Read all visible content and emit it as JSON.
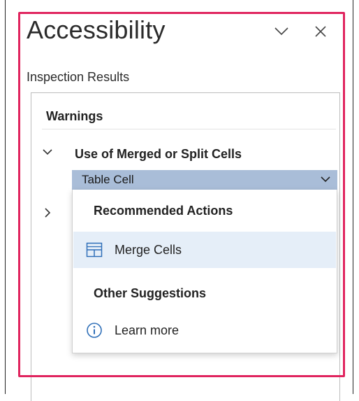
{
  "pane": {
    "title": "Accessibility",
    "section_label": "Inspection Results"
  },
  "results": {
    "warnings_heading": "Warnings",
    "issue": {
      "title": "Use of Merged or Split Cells",
      "expanded": true
    },
    "dropdown": {
      "selected": "Table Cell"
    }
  },
  "menu": {
    "recommended_heading": "Recommended Actions",
    "merge_label": "Merge Cells",
    "other_heading": "Other Suggestions",
    "learn_more_label": "Learn more"
  },
  "icons": {
    "options": "chevron-down-icon",
    "close": "close-icon",
    "expand": "chevron-down-icon",
    "collapsed": "chevron-right-icon",
    "merge": "table-cells-icon",
    "info": "info-icon"
  },
  "colors": {
    "highlight": "#e0245e",
    "dropdown_bg": "#a9bdd8",
    "menu_hover": "#e5eef8",
    "info_blue": "#2f6fb8"
  }
}
